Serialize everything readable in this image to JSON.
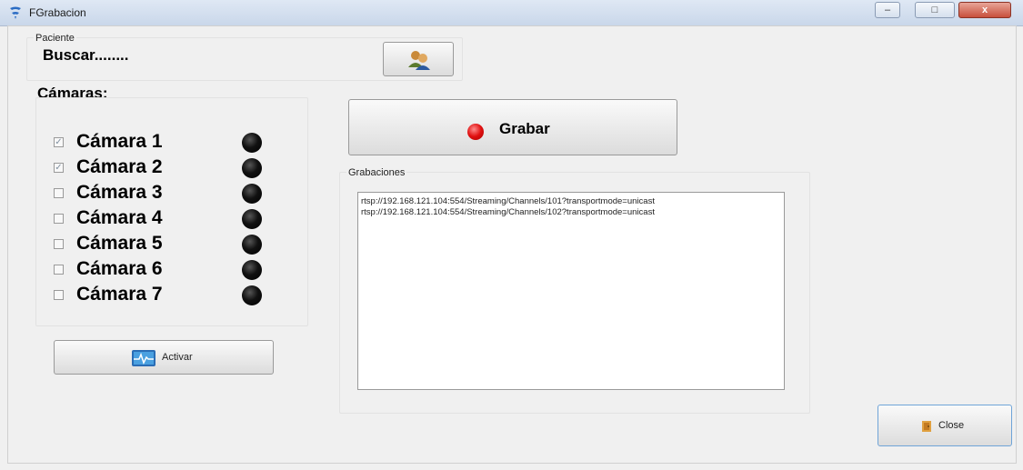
{
  "window": {
    "title": "FGrabacion",
    "icon": "app-icon",
    "controls": [
      {
        "name": "minimize-button",
        "glyph": "–"
      },
      {
        "name": "maximize-button",
        "glyph": "□"
      },
      {
        "name": "close-button",
        "glyph": "x"
      }
    ]
  },
  "paciente": {
    "group_label": "Paciente",
    "search_text": "Buscar........",
    "search_button_icon": "users-icon"
  },
  "cameras": {
    "title": "Cámaras:",
    "items": [
      {
        "label": "Cámara 1",
        "checked": true
      },
      {
        "label": "Cámara 2",
        "checked": true
      },
      {
        "label": "Cámara 3",
        "checked": false
      },
      {
        "label": "Cámara 4",
        "checked": false
      },
      {
        "label": "Cámara 5",
        "checked": false
      },
      {
        "label": "Cámara 6",
        "checked": false
      },
      {
        "label": "Cámara 7",
        "checked": false
      }
    ],
    "status_indicator": "black-led"
  },
  "activar_button": {
    "label": "Activar",
    "icon": "monitor-pulse-icon"
  },
  "grabar_button": {
    "label": "Grabar",
    "icon": "red-record-dot",
    "accent": "#e01010"
  },
  "grabaciones": {
    "group_label": "Grabaciones",
    "items": [
      "rtsp://192.168.121.104:554/Streaming/Channels/101?transportmode=unicast",
      "rtsp://192.168.121.104:554/Streaming/Channels/102?transportmode=unicast"
    ]
  },
  "close_button": {
    "label": "Close",
    "icon": "door-icon"
  }
}
